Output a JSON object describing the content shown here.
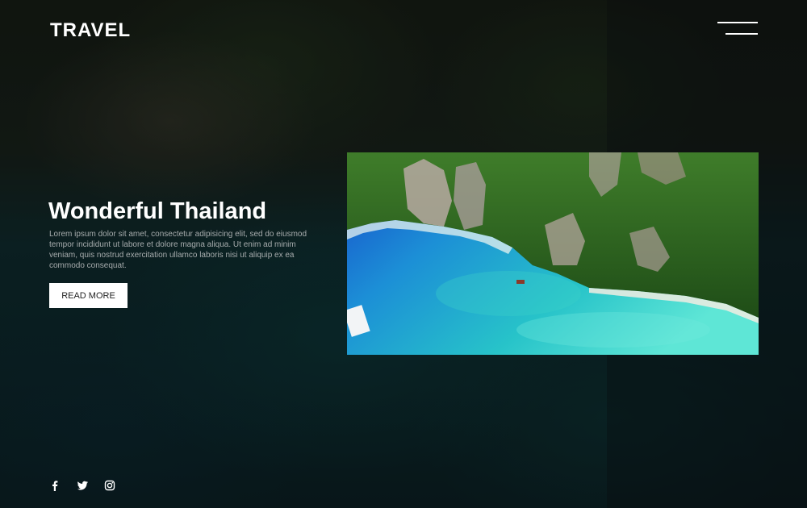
{
  "brand": {
    "logo_text": "TRAVEL"
  },
  "header": {
    "menu_icon": "hamburger-menu-icon"
  },
  "hero": {
    "title": "Wonderful Thailand",
    "description": "Lorem ipsum dolor sit amet, consectetur adipisicing elit, sed do eiusmod tempor incididunt ut labore et dolore magna aliqua. Ut enim ad minim veniam, quis nostrud exercitation ullamco laboris nisi ut aliquip ex ea commodo consequat.",
    "button_label": "READ MORE"
  },
  "feature_image": {
    "subject": "aerial view of tropical lagoon with limestone cliffs"
  },
  "social": {
    "icons": [
      "facebook-icon",
      "twitter-icon",
      "instagram-icon"
    ]
  },
  "colors": {
    "text_primary": "#ffffff",
    "text_muted": "#a7acad",
    "lagoon_turquoise": "#2fd4cf",
    "jungle_green": "#2f6b23"
  }
}
